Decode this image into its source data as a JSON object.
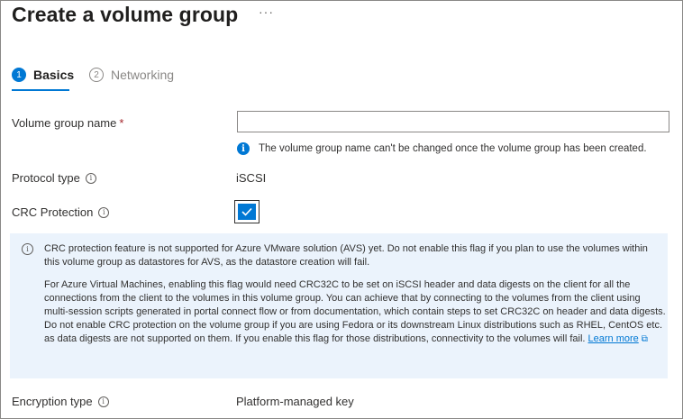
{
  "header": {
    "title": "Create a volume group",
    "more_label": "···"
  },
  "tabs": [
    {
      "number": "1",
      "label": "Basics",
      "active": true
    },
    {
      "number": "2",
      "label": "Networking",
      "active": false
    }
  ],
  "form": {
    "volume_group_name": {
      "label": "Volume group name",
      "required_mark": "*",
      "value": "",
      "hint": "The volume group name can't be changed once the volume group has been created."
    },
    "protocol_type": {
      "label": "Protocol type",
      "value": "iSCSI"
    },
    "crc_protection": {
      "label": "CRC Protection",
      "checked": true
    },
    "encryption_type": {
      "label": "Encryption type",
      "value": "Platform-managed key"
    }
  },
  "info_box": {
    "paragraph1": "CRC protection feature is not supported for Azure VMware solution (AVS) yet. Do not enable this flag if you plan to use the volumes within this volume group as datastores for AVS, as the datastore creation will fail.",
    "paragraph2": "For Azure Virtual Machines, enabling this flag would need CRC32C to be set on iSCSI header and data digests on the client for all the connections from the client to the volumes in this volume group. You can achieve that by connecting to the volumes from the client using multi-session scripts generated in portal connect flow or from documentation, which contain steps to set CRC32C on header and data digests. Do not enable CRC protection on the volume group if you are using Fedora or its downstream Linux distributions such as RHEL, CentOS etc. as data digests are not supported on them. If you enable this flag for those distributions, connectivity to the volumes will fail.",
    "learn_more": "Learn more"
  },
  "icons": {
    "info": "info-icon",
    "external_link": "external-link-icon",
    "checkmark": "checkmark-icon"
  },
  "colors": {
    "accent": "#0078d4",
    "info_box_bg": "#ebf3fc",
    "required": "#a4262c"
  }
}
